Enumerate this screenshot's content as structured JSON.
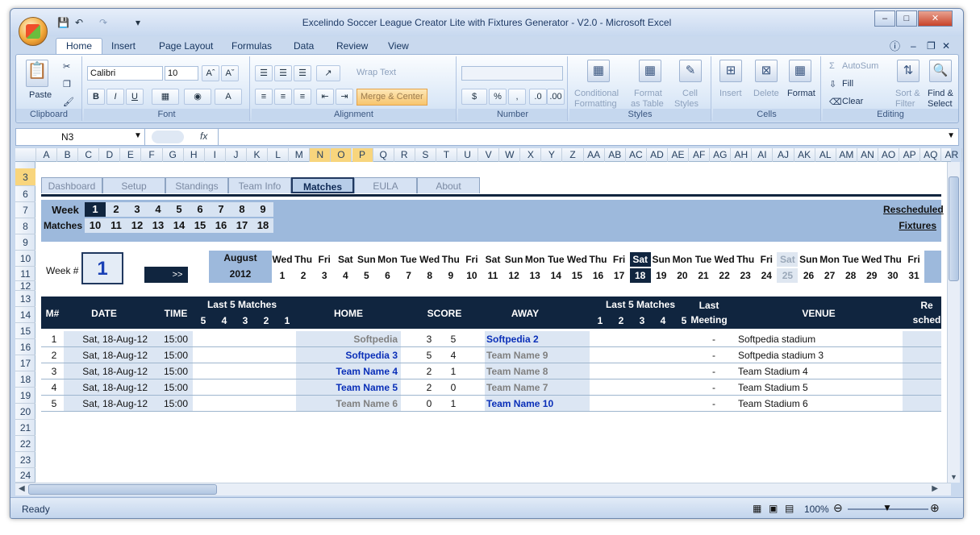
{
  "window": {
    "title": "Excelindo Soccer League Creator Lite with Fixtures Generator - V2.0  -  Microsoft Excel"
  },
  "ribbon": {
    "tabs": [
      "Home",
      "Insert",
      "Page Layout",
      "Formulas",
      "Data",
      "Review",
      "View"
    ],
    "clipboard": {
      "paste": "Paste",
      "label": "Clipboard"
    },
    "font": {
      "name": "Calibri",
      "size": "10",
      "label": "Font",
      "bold": "B",
      "italic": "I",
      "underline": "U"
    },
    "alignment": {
      "wrap": "Wrap Text",
      "merge": "Merge & Center",
      "label": "Alignment"
    },
    "number": {
      "currency": "$",
      "percent": "%",
      "comma": ",",
      "label": "Number"
    },
    "styles": {
      "conditional1": "Conditional",
      "conditional2": "Formatting",
      "format_table1": "Format",
      "format_table2": "as Table",
      "cell_styles1": "Cell",
      "cell_styles2": "Styles",
      "label": "Styles"
    },
    "cells": {
      "insert": "Insert",
      "delete": "Delete",
      "format": "Format",
      "label": "Cells"
    },
    "editing": {
      "autosum": "AutoSum",
      "fill": "Fill",
      "clear": "Clear",
      "sort1": "Sort &",
      "sort2": "Filter",
      "find1": "Find &",
      "find2": "Select",
      "label": "Editing"
    }
  },
  "formula_bar": {
    "name_box": "N3",
    "fx": "fx",
    "formula": ""
  },
  "columns": [
    "A",
    "B",
    "C",
    "D",
    "E",
    "F",
    "G",
    "H",
    "I",
    "J",
    "K",
    "L",
    "M",
    "N",
    "O",
    "P",
    "Q",
    "R",
    "S",
    "T",
    "U",
    "V",
    "W",
    "X",
    "Y",
    "Z",
    "AA",
    "AB",
    "AC",
    "AD",
    "AE",
    "AF",
    "AG",
    "AH",
    "AI",
    "AJ",
    "AK",
    "AL",
    "AM",
    "AN",
    "AO",
    "AP",
    "AQ",
    "AR"
  ],
  "selected_columns": [
    "N",
    "O",
    "P"
  ],
  "rows": [
    "3",
    "6",
    "7",
    "8",
    "9",
    "10",
    "11",
    "12",
    "13",
    "14",
    "15",
    "16",
    "17",
    "18",
    "19",
    "20",
    "21",
    "22",
    "23",
    "24"
  ],
  "selected_row": "3",
  "sheet_tabs": [
    "Dashboard",
    "Setup",
    "Standings",
    "Team Info",
    "Matches",
    "EULA",
    "About"
  ],
  "active_tab": "Matches",
  "week_selector": {
    "week_label": "Week",
    "matches_label": "Matches",
    "weeks": [
      "1",
      "2",
      "3",
      "4",
      "5",
      "6",
      "7",
      "8",
      "9"
    ],
    "selected_week": "1",
    "matches": [
      "10",
      "11",
      "12",
      "13",
      "14",
      "15",
      "16",
      "17",
      "18"
    ],
    "rescheduled1": "Rescheduled",
    "rescheduled2": "Fixtures"
  },
  "week_control": {
    "label": "Week #",
    "value": "1",
    "next": ">>"
  },
  "calendar": {
    "month": "August",
    "year": "2012",
    "days": [
      "Wed",
      "Thu",
      "Fri",
      "Sat",
      "Sun",
      "Mon",
      "Tue",
      "Wed",
      "Thu",
      "Fri",
      "Sat",
      "Sun",
      "Mon",
      "Tue",
      "Wed",
      "Thu",
      "Fri",
      "Sat",
      "Sun",
      "Mon",
      "Tue",
      "Wed",
      "Thu",
      "Fri",
      "Sat",
      "Sun",
      "Mon",
      "Tue",
      "Wed",
      "Thu",
      "Fri"
    ],
    "dates": [
      "1",
      "2",
      "3",
      "4",
      "5",
      "6",
      "7",
      "8",
      "9",
      "10",
      "11",
      "12",
      "13",
      "14",
      "15",
      "16",
      "17",
      "18",
      "19",
      "20",
      "21",
      "22",
      "23",
      "24",
      "25",
      "26",
      "27",
      "28",
      "29",
      "30",
      "31"
    ],
    "highlight": "18",
    "grey": "25"
  },
  "matches_header": {
    "num": "M#",
    "date": "DATE",
    "time": "TIME",
    "last5": "Last 5 Matches",
    "last5_nums": [
      "5",
      "4",
      "3",
      "2",
      "1"
    ],
    "home": "HOME",
    "score": "SCORE",
    "away": "AWAY",
    "last5_away_nums": [
      "1",
      "2",
      "3",
      "4",
      "5"
    ],
    "last_meeting1": "Last",
    "last_meeting2": "Meeting",
    "venue": "VENUE",
    "resched1": "Re",
    "resched2": "sched"
  },
  "matches": [
    {
      "num": "1",
      "date": "Sat, 18-Aug-12",
      "time": "15:00",
      "home": "Softpedia",
      "home_style": "grey",
      "hs": "3",
      "as": "5",
      "away": "Softpedia 2",
      "away_style": "blue",
      "meeting": "-",
      "venue": "Softpedia stadium"
    },
    {
      "num": "2",
      "date": "Sat, 18-Aug-12",
      "time": "15:00",
      "home": "Softpedia 3",
      "home_style": "blue",
      "hs": "5",
      "as": "4",
      "away": "Team Name 9",
      "away_style": "grey",
      "meeting": "-",
      "venue": "Softpedia stadium 3"
    },
    {
      "num": "3",
      "date": "Sat, 18-Aug-12",
      "time": "15:00",
      "home": "Team Name 4",
      "home_style": "blue",
      "hs": "2",
      "as": "1",
      "away": "Team Name 8",
      "away_style": "grey",
      "meeting": "-",
      "venue": "Team Stadium 4"
    },
    {
      "num": "4",
      "date": "Sat, 18-Aug-12",
      "time": "15:00",
      "home": "Team Name 5",
      "home_style": "blue",
      "hs": "2",
      "as": "0",
      "away": "Team Name 7",
      "away_style": "grey",
      "meeting": "-",
      "venue": "Team Stadium 5"
    },
    {
      "num": "5",
      "date": "Sat, 18-Aug-12",
      "time": "15:00",
      "home": "Team Name 6",
      "home_style": "grey",
      "hs": "0",
      "as": "1",
      "away": "Team Name 10",
      "away_style": "blue",
      "meeting": "-",
      "venue": "Team Stadium 6"
    }
  ],
  "status": {
    "ready": "Ready",
    "zoom": "100%"
  },
  "colors": {
    "navy": "#10253f",
    "blue_text": "#0a2fb8",
    "grey_text": "#808080",
    "select": "#f8d57d"
  }
}
